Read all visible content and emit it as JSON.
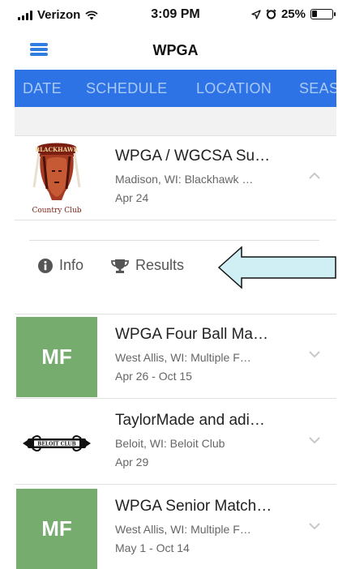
{
  "status_bar": {
    "carrier": "Verizon",
    "time": "3:09 PM",
    "battery": "25%",
    "battery_level": 0.25
  },
  "header": {
    "title": "WPGA"
  },
  "tabs": [
    {
      "label": "DATE"
    },
    {
      "label": "SCHEDULE"
    },
    {
      "label": "LOCATION"
    },
    {
      "label": "SEAS"
    }
  ],
  "events": [
    {
      "title": "WPGA / WGCSA Su…",
      "location": "Madison, WI: Blackhawk …",
      "date": "Apr 24",
      "logo_text": "BLACKHAWK",
      "logo_caption": "Country Club",
      "expanded": true
    },
    {
      "title": "WPGA Four Ball Ma…",
      "location": "West Allis, WI: Multiple F…",
      "date": "Apr 26 - Oct 15",
      "thumb": "MF"
    },
    {
      "title": "TaylorMade and adi…",
      "location": "Beloit, WI: Beloit Club",
      "date": "Apr 29",
      "logo_text": "BELOIT CLUB"
    },
    {
      "title": "WPGA Senior Match…",
      "location": "West Allis, WI: Multiple F…",
      "date": "May 1 - Oct 14",
      "thumb": "MF"
    }
  ],
  "actions": {
    "info_label": "Info",
    "results_label": "Results"
  },
  "colors": {
    "tab_bar": "#2e73e6",
    "tab_text": "#a9c9f7",
    "mf_tile": "#76ac6e",
    "hamburger": "#2f7de0",
    "annotation_arrow": "#cfeff4"
  },
  "icons": [
    "wifi-icon",
    "location-arrow-icon",
    "alarm-icon",
    "battery-icon",
    "hamburger-menu-icon",
    "chevron-up-icon",
    "chevron-down-icon",
    "info-circle-icon",
    "trophy-icon",
    "left-arrow-annotation"
  ]
}
